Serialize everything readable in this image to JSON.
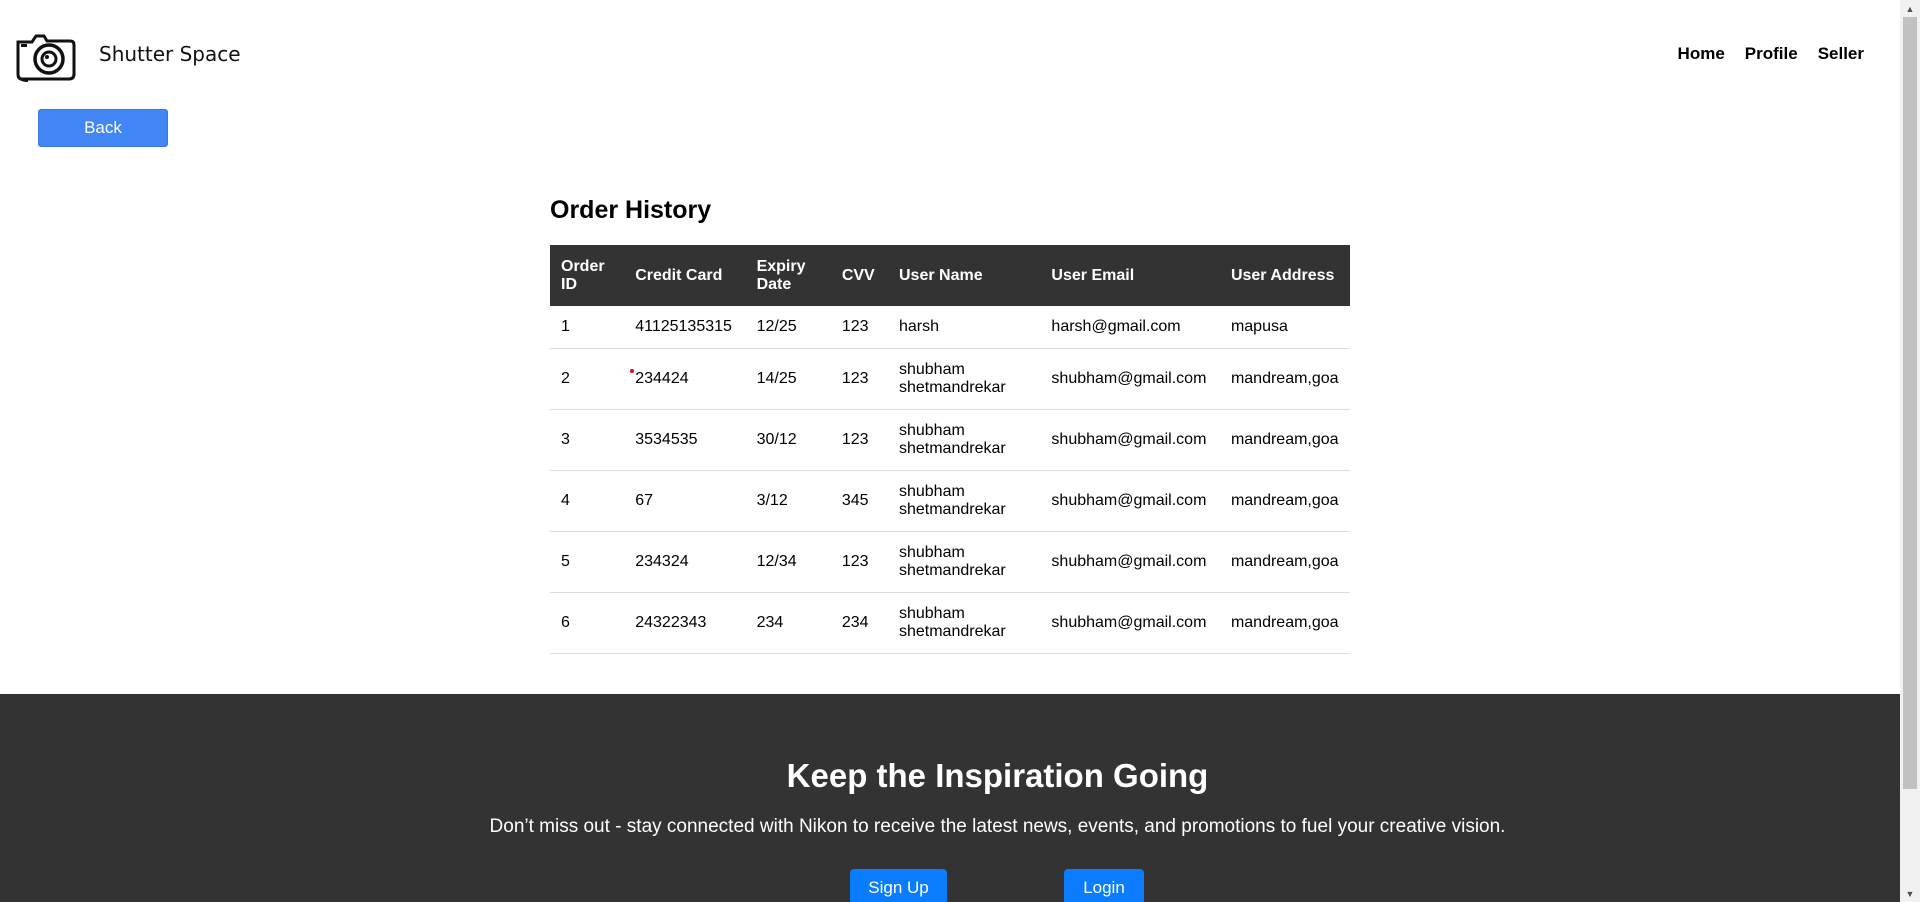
{
  "header": {
    "brand": "Shutter Space",
    "nav": [
      "Home",
      "Profile",
      "Seller"
    ]
  },
  "back_label": "Back",
  "orders": {
    "title": "Order History",
    "columns": [
      [
        "Order",
        "ID"
      ],
      [
        "Credit Card"
      ],
      [
        "Expiry",
        "Date"
      ],
      [
        "CVV"
      ],
      [
        "User Name"
      ],
      [
        "User Email"
      ],
      [
        "User Address"
      ]
    ],
    "rows": [
      {
        "id": "1",
        "card": "41125135315",
        "expiry": "12/25",
        "cvv": "123",
        "name": [
          "harsh"
        ],
        "email": "harsh@gmail.com",
        "address": "mapusa"
      },
      {
        "id": "2",
        "card": "234424",
        "expiry": "14/25",
        "cvv": "123",
        "name": [
          "shubham",
          "shetmandrekar"
        ],
        "email": "shubham@gmail.com",
        "address": "mandream,goa"
      },
      {
        "id": "3",
        "card": "3534535",
        "expiry": "30/12",
        "cvv": "123",
        "name": [
          "shubham",
          "shetmandrekar"
        ],
        "email": "shubham@gmail.com",
        "address": "mandream,goa"
      },
      {
        "id": "4",
        "card": "67",
        "expiry": "3/12",
        "cvv": "345",
        "name": [
          "shubham",
          "shetmandrekar"
        ],
        "email": "shubham@gmail.com",
        "address": "mandream,goa"
      },
      {
        "id": "5",
        "card": "234324",
        "expiry": "12/34",
        "cvv": "123",
        "name": [
          "shubham",
          "shetmandrekar"
        ],
        "email": "shubham@gmail.com",
        "address": "mandream,goa"
      },
      {
        "id": "6",
        "card": "24322343",
        "expiry": "234",
        "cvv": "234",
        "name": [
          "shubham",
          "shetmandrekar"
        ],
        "email": "shubham@gmail.com",
        "address": "mandream,goa"
      }
    ]
  },
  "footer": {
    "title": "Keep the Inspiration Going",
    "text": "Don’t miss out - stay connected with Nikon to receive the latest news, events, and promotions to fuel your creative vision.",
    "signup_label": "Sign Up",
    "login_label": "Login"
  },
  "colors": {
    "accent_blue": "#4285f4",
    "footer_button_blue": "#0b7dfc",
    "dark": "#333333"
  },
  "icons": {
    "logo": "camera-icon",
    "scroll_up": "triangle-up-icon",
    "scroll_down": "triangle-down-icon"
  }
}
